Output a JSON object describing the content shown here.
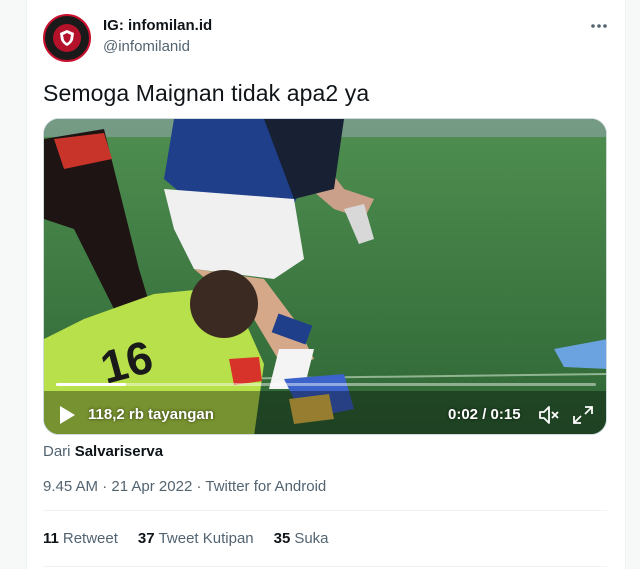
{
  "author": {
    "display_name": "IG: infomilan.id",
    "handle": "@infomilanid",
    "avatar_icon": "shield-icon"
  },
  "tweet": {
    "text": "Semoga Maignan tidak apa2 ya",
    "more_icon": "more-horizontal-icon"
  },
  "video": {
    "views": "118,2 rb tayangan",
    "time": "0:02 / 0:15",
    "progress": 0.13
  },
  "source": {
    "prefix": "Dari",
    "name": "Salvariserva"
  },
  "meta": {
    "time": "9.45 AM",
    "date": "21 Apr 2022",
    "client": "Twitter for Android",
    "separator": "·"
  },
  "stats": {
    "retweets_count": "11",
    "retweets_label": "Retweet",
    "quotes_count": "37",
    "quotes_label": "Tweet Kutipan",
    "likes_count": "35",
    "likes_label": "Suka"
  },
  "colors": {
    "text_primary": "#0f1419",
    "text_secondary": "#536471",
    "pitch_green": "#3d7d45",
    "keeper_kit": "#b7e04a"
  }
}
